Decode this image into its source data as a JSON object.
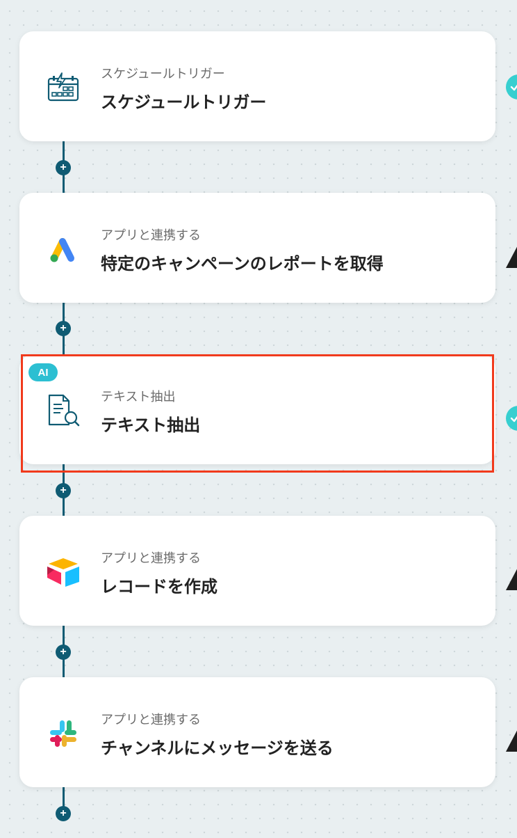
{
  "flow": {
    "steps": [
      {
        "subtitle": "スケジュールトリガー",
        "title": "スケジュールトリガー",
        "icon": "calendar-bolt-icon",
        "status": "complete"
      },
      {
        "subtitle": "アプリと連携する",
        "title": "特定のキャンペーンのレポートを取得",
        "icon": "google-ads-icon",
        "status": "warning"
      },
      {
        "badge": "AI",
        "subtitle": "テキスト抽出",
        "title": "テキスト抽出",
        "icon": "document-search-icon",
        "status": "complete",
        "highlighted": true
      },
      {
        "subtitle": "アプリと連携する",
        "title": "レコードを作成",
        "icon": "airtable-icon",
        "status": "warning"
      },
      {
        "subtitle": "アプリと連携する",
        "title": "チャンネルにメッセージを送る",
        "icon": "slack-icon",
        "status": "warning"
      }
    ]
  },
  "colors": {
    "connector": "#0f5b73",
    "accent_teal": "#2cbfd2",
    "highlight": "#f13a1c",
    "background": "#e9eff1"
  }
}
